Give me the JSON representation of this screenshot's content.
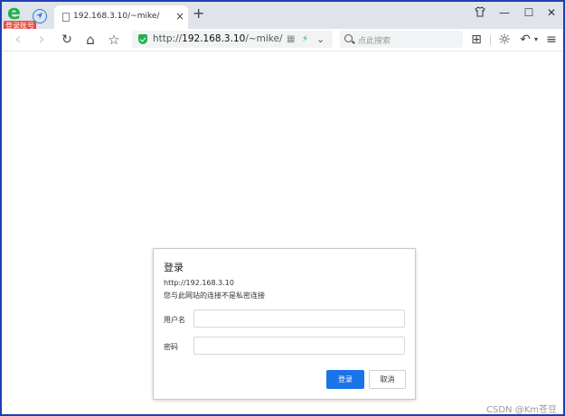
{
  "browser": {
    "login_badge": "登录账号",
    "tab": {
      "title": "192.168.3.10/~mike/",
      "close": "×"
    },
    "new_tab": "+",
    "window_controls": {
      "shirt": "👕",
      "minimize": "—",
      "maximize": "☐",
      "close": "✕"
    },
    "toolbar": {
      "back": "‹",
      "forward": "›",
      "reload": "↻",
      "home": "⌂",
      "favorite": "☆",
      "url_scheme": "http://",
      "url_host": "192.168.3.10",
      "url_path": "/~mike/",
      "grid_glyph": "▦",
      "lightning_glyph": "⚡",
      "dropdown_glyph": "⌄",
      "search_placeholder": "点此搜索",
      "apps_glyph": "⊞",
      "brightness_glyph": "☼",
      "undo_glyph": "↶",
      "undo_caret": "▾",
      "menu_glyph": "≡"
    },
    "icons": [
      "browser-logo-icon",
      "navigation-icon",
      "page-icon",
      "shirt-icon",
      "back-arrow-icon",
      "forward-arrow-icon",
      "reload-icon",
      "home-icon",
      "star-icon",
      "shield-icon",
      "lightning-icon",
      "search-icon",
      "apps-grid-icon",
      "brightness-icon",
      "undo-icon",
      "menu-icon"
    ],
    "colors": {
      "frame": "#1f3fb0",
      "tab_strip": "#dfe3ea",
      "shield": "#22b14c",
      "accent": "#1a73e8"
    }
  },
  "dialog": {
    "title": "登录",
    "url": "http://192.168.3.10",
    "warning": "您与此网站的连接不是私密连接",
    "username_label": "用户名",
    "username_value": "",
    "password_label": "密码",
    "password_value": "",
    "login_button": "登录",
    "cancel_button": "取消"
  },
  "watermark": "CSDN @Km苍豆"
}
